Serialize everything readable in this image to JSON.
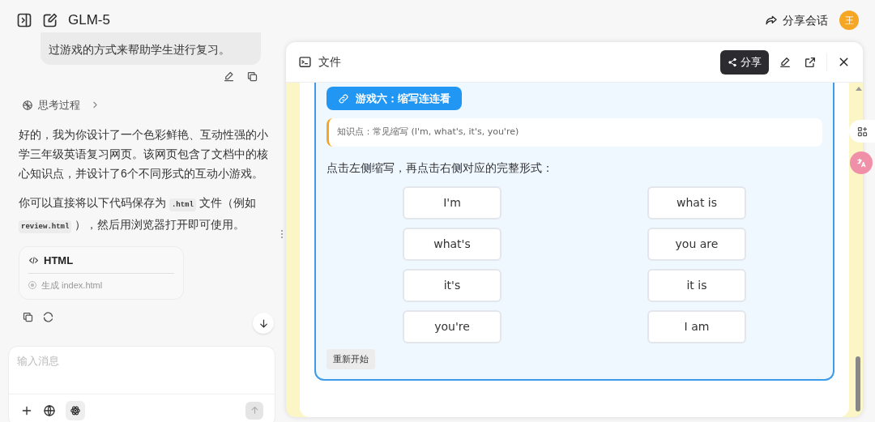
{
  "header": {
    "title": "GLM-5",
    "share_label": "分享会话",
    "avatar": "王"
  },
  "chat": {
    "user_message": "过游戏的方式来帮助学生进行复习。",
    "thinking_label": "思考过程",
    "reply": [
      [
        {
          "kind": "text",
          "text": "好的，我为你设计了一个色彩鲜艳、互动性强的小学三年级英语复习网页。该网页包含了文档中的核心知识点，并设计了6个不同形式的互动小游戏。"
        }
      ],
      [
        {
          "kind": "text",
          "text": "你可以直接将以下代码保存为 "
        },
        {
          "kind": "code",
          "text": ".html"
        },
        {
          "kind": "text",
          "text": " 文件（例如 "
        },
        {
          "kind": "code",
          "text": "review.html"
        },
        {
          "kind": "text",
          "text": " ），然后用浏览器打开即可使用。"
        }
      ]
    ],
    "file_card": {
      "title": "HTML",
      "status": "生成 index.html"
    },
    "input": {
      "placeholder": "输入消息"
    }
  },
  "panel": {
    "title": "文件",
    "share_label": "分享",
    "game": {
      "title": "游戏六：缩写连连看",
      "hint": "知识点：常见缩写 (I'm, what's, it's, you're)",
      "instruction": "点击左侧缩写，再点击右侧对应的完整形式：",
      "left": [
        "I'm",
        "what's",
        "it's",
        "you're"
      ],
      "right": [
        "what is",
        "you are",
        "it is",
        "I am"
      ],
      "restart": "重新开始"
    }
  }
}
